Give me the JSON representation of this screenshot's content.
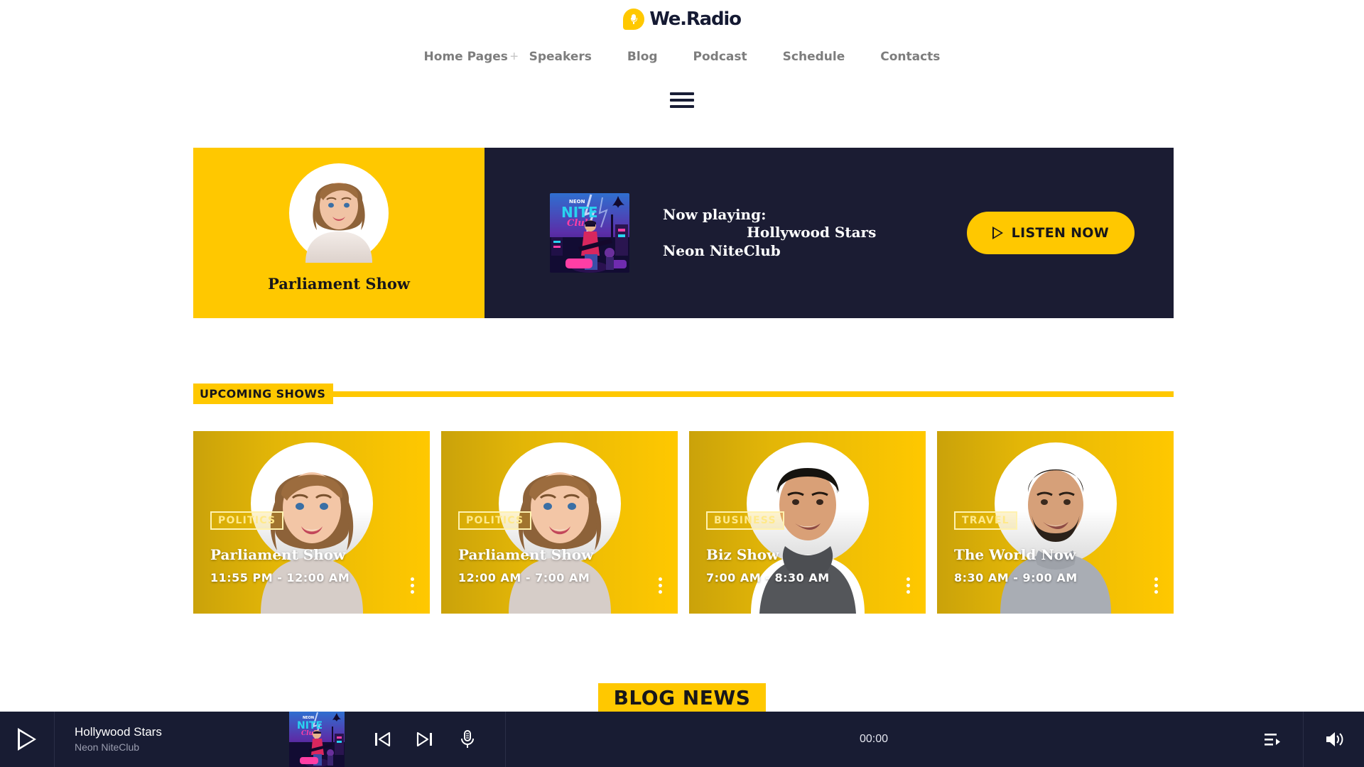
{
  "brand": {
    "name": "We.Radio",
    "logo_icon": "microphone-bubble-icon",
    "accent": "#FFC800",
    "dark": "#181c33"
  },
  "nav": {
    "items": [
      {
        "label": "Home Pages",
        "has_plus": true
      },
      {
        "label": "Speakers",
        "has_plus": false
      },
      {
        "label": "Blog",
        "has_plus": false
      },
      {
        "label": "Podcast",
        "has_plus": false
      },
      {
        "label": "Schedule",
        "has_plus": false
      },
      {
        "label": "Contacts",
        "has_plus": false
      }
    ],
    "plus_glyph": "+",
    "hamburger_icon": "hamburger-menu-icon"
  },
  "hero": {
    "show_title": "Parliament Show",
    "host_photo_alt": "smiling-woman-host-portrait",
    "now_playing_label": "Now playing:",
    "track": "Hollywood Stars",
    "album": "Neon NiteClub",
    "cover_alt": "neon-nite-club-album-art",
    "cover_text_top": "NEON",
    "cover_text_mid": "NITE",
    "cover_text_bottom": "Club",
    "listen_button": "LISTEN NOW",
    "listen_icon": "play-triangle-icon"
  },
  "upcoming": {
    "section_label": "UPCOMING SHOWS",
    "cards": [
      {
        "badge": "POLITICS",
        "title": "Parliament Show",
        "time": "11:55 PM - 12:00 AM",
        "photo_alt": "woman-host-portrait",
        "menu_icon": "kebab-menu-icon"
      },
      {
        "badge": "POLITICS",
        "title": "Parliament Show",
        "time": "12:00 AM - 7:00 AM",
        "photo_alt": "woman-host-portrait",
        "menu_icon": "kebab-menu-icon"
      },
      {
        "badge": "BUSINESS",
        "title": "Biz Show",
        "time": "7:00 AM - 8:30 AM",
        "photo_alt": "man-dark-hair-scarf-portrait",
        "menu_icon": "kebab-menu-icon"
      },
      {
        "badge": "TRAVEL",
        "title": "The World Now",
        "time": "8:30 AM - 9:00 AM",
        "photo_alt": "man-beard-grey-shirt-portrait",
        "menu_icon": "kebab-menu-icon"
      }
    ]
  },
  "blog": {
    "section_label": "BLOG NEWS"
  },
  "player": {
    "play_icon": "play-icon",
    "track": "Hollywood Stars",
    "artist": "Neon NiteClub",
    "cover_alt": "neon-nite-club-album-art",
    "prev_icon": "skip-previous-icon",
    "next_icon": "skip-next-icon",
    "mic_icon": "microphone-icon",
    "time": "00:00",
    "playlist_icon": "playlist-icon",
    "volume_icon": "volume-icon"
  }
}
